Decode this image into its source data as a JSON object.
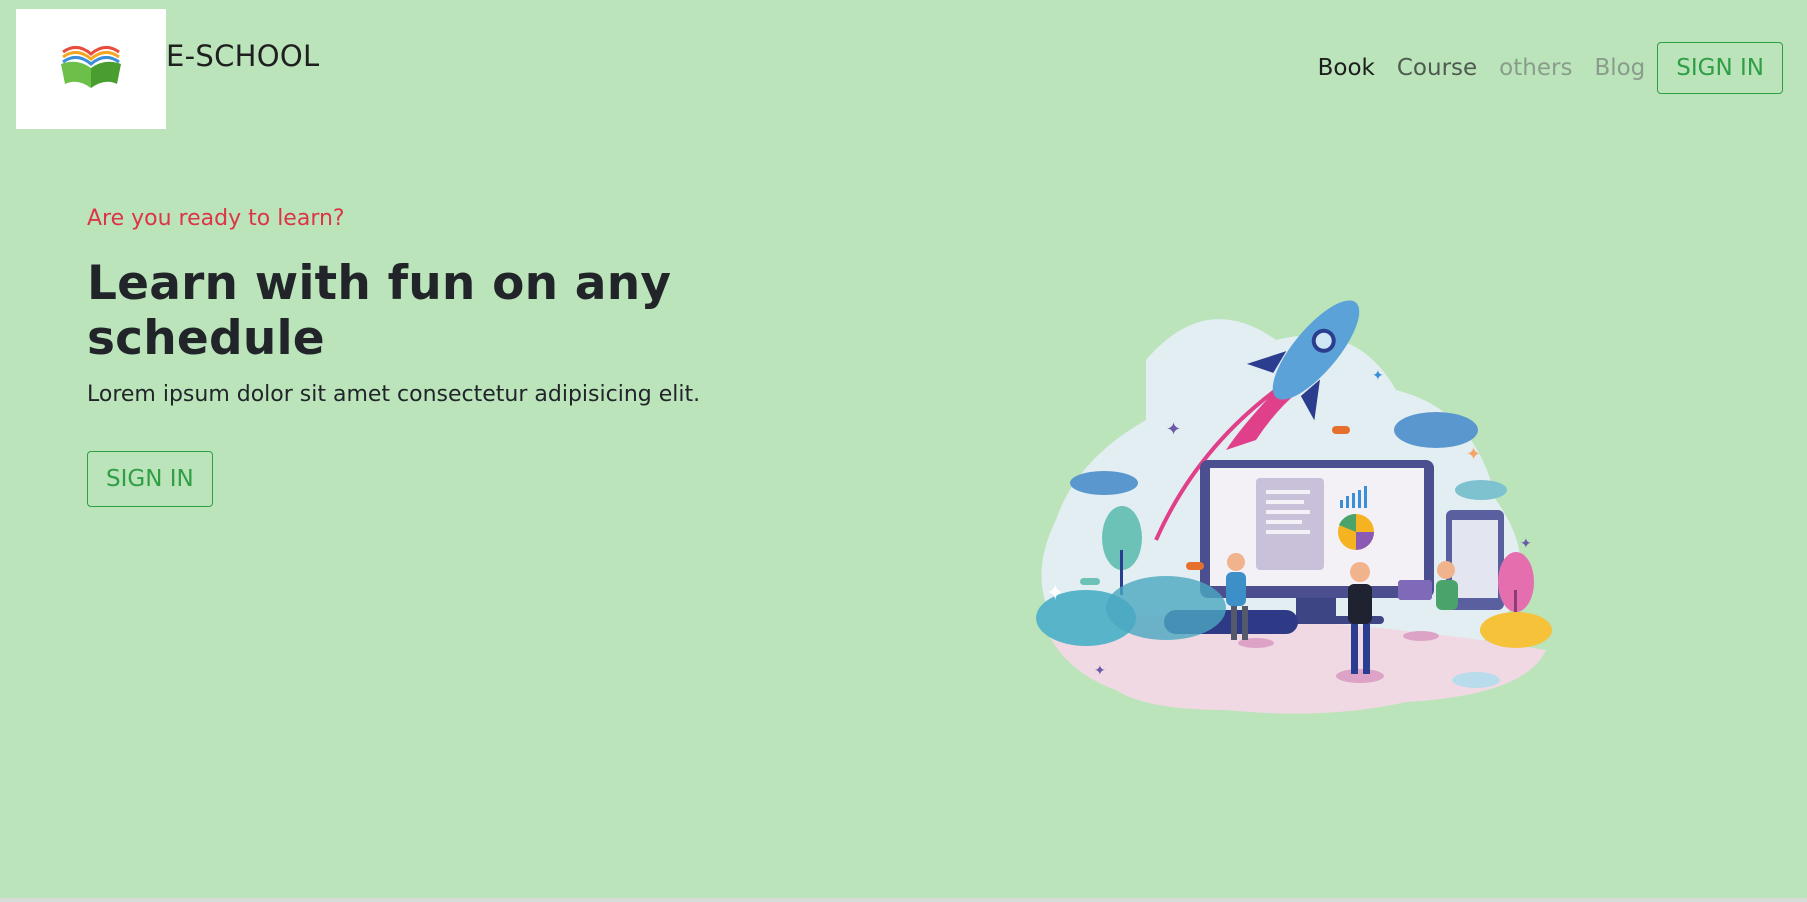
{
  "navbar": {
    "brand": "E-SCHOOL",
    "links": [
      {
        "label": "Book"
      },
      {
        "label": "Course"
      },
      {
        "label": "others"
      },
      {
        "label": "Blog"
      }
    ],
    "signin_label": "SIGN IN"
  },
  "hero": {
    "eyebrow": "Are you ready to learn?",
    "headline": "Learn with fun on any schedule",
    "subtext": "Lorem ipsum dolor sit amet consectetur adipisicing elit.",
    "signin_label": "SIGN IN"
  },
  "colors": {
    "background": "#bbe4bb",
    "accent_green": "#2f9e44",
    "eyebrow_red": "#dc3545",
    "text_dark": "#212529"
  },
  "icons": {
    "logo": "open-book-icon",
    "illustration": "rocket-computer-learning-illustration"
  }
}
